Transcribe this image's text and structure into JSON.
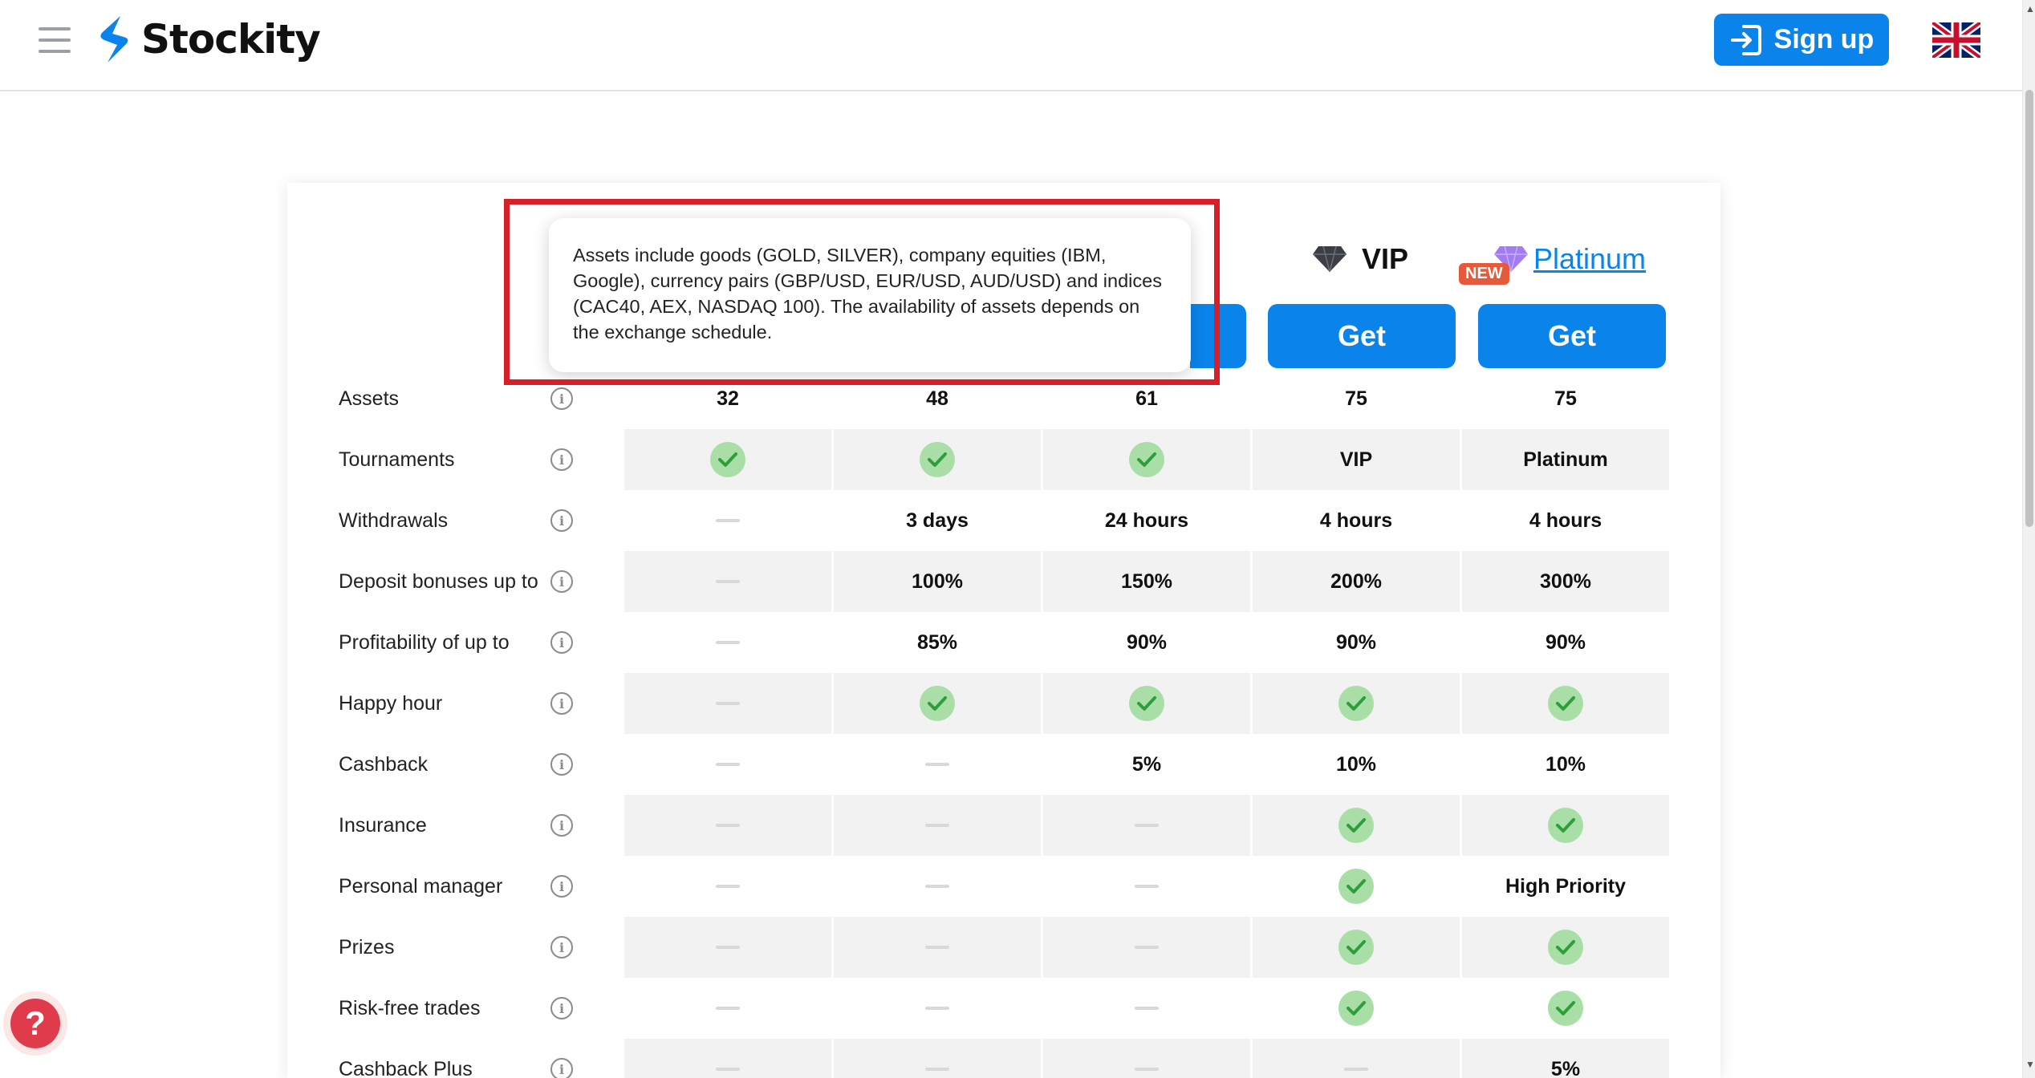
{
  "header": {
    "brand": "Stockity",
    "signup_label": "Sign up"
  },
  "tooltip": {
    "text": "Assets include goods (GOLD, SILVER), company equities (IBM, Google), currency pairs (GBP/USD, EUR/USD, AUD/USD) and indices (CAC40, AEX, NASDAQ 100). The availability of assets depends on the exchange schedule."
  },
  "plans": {
    "vip": "VIP",
    "platinum": "Platinum",
    "new_badge": "NEW",
    "get_label": "Get"
  },
  "rows": [
    {
      "label": "Assets",
      "cells": [
        "32",
        "48",
        "61",
        "75",
        "75"
      ]
    },
    {
      "label": "Tournaments",
      "cells": [
        "check",
        "check",
        "check",
        "VIP",
        "Platinum"
      ]
    },
    {
      "label": "Withdrawals",
      "cells": [
        "dash",
        "3 days",
        "24 hours",
        "4 hours",
        "4 hours"
      ]
    },
    {
      "label": "Deposit bonuses up to",
      "cells": [
        "dash",
        "100%",
        "150%",
        "200%",
        "300%"
      ]
    },
    {
      "label": "Profitability of up to",
      "cells": [
        "dash",
        "85%",
        "90%",
        "90%",
        "90%"
      ]
    },
    {
      "label": "Happy hour",
      "cells": [
        "dash",
        "check",
        "check",
        "check",
        "check"
      ]
    },
    {
      "label": "Cashback",
      "cells": [
        "dash",
        "dash",
        "5%",
        "10%",
        "10%"
      ]
    },
    {
      "label": "Insurance",
      "cells": [
        "dash",
        "dash",
        "dash",
        "check",
        "check"
      ]
    },
    {
      "label": "Personal manager",
      "cells": [
        "dash",
        "dash",
        "dash",
        "check",
        "High Priority"
      ]
    },
    {
      "label": "Prizes",
      "cells": [
        "dash",
        "dash",
        "dash",
        "check",
        "check"
      ]
    },
    {
      "label": "Risk-free trades",
      "cells": [
        "dash",
        "dash",
        "dash",
        "check",
        "check"
      ]
    },
    {
      "label": "Cashback Plus",
      "cells": [
        "dash",
        "dash",
        "dash",
        "dash",
        "5%"
      ]
    }
  ],
  "colors": {
    "accent": "#0a84ea",
    "check_bg": "#a9dfa6",
    "check_mark": "#2e9e3c",
    "highlight": "#d61f26",
    "new_badge": "#e65a3c"
  }
}
